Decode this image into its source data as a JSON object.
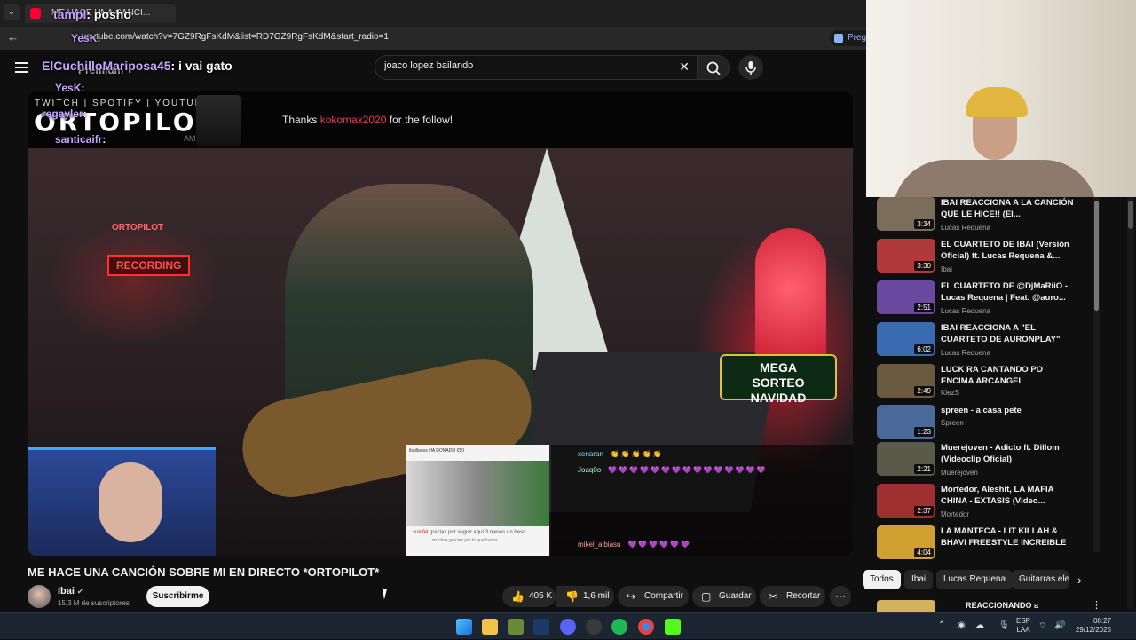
{
  "browser": {
    "tab_title": "ME HACE UNA CANCI...",
    "url": "youtube.com/watch?v=7GZ9RgFsKdM&list=RD7GZ9RgFsKdM&start_radio=1",
    "translate_label": "Preg"
  },
  "search": {
    "query": "joaco lopez bailando",
    "clear_icon": "close-icon",
    "search_icon": "search-icon",
    "mic_icon": "mic-icon"
  },
  "overlay_chat": [
    {
      "name": "tampl",
      "text": "posho"
    },
    {
      "name": "YesK",
      "text": "Premium"
    },
    {
      "name": "ElCuchilloMariposa45",
      "text": "i vai gato"
    },
    {
      "name": "YesK",
      "text": ""
    },
    {
      "name": "regayler",
      "text": ""
    },
    {
      "name": "santicaifr",
      "text": ""
    }
  ],
  "player": {
    "banner_top": "TWITCH | SPOTIFY | YOUTUBE",
    "banner_brand": "ORTOPILOT",
    "banner_am": "AM",
    "follow_prefix": "Thanks ",
    "follow_user": "kokomax2020",
    "follow_suffix": " for the follow!",
    "rec_sign": "RECORDING",
    "orto_sign": "ORTOPILOT",
    "sorteo_line1": "MEGA",
    "sorteo_line2": "SORTEO",
    "sorteo_line3": "NAVIDAD",
    "donation_title": "ibaillanos HA DONADO €50",
    "donation_msg": "gracias por seguir aquí 3 meses un beso",
    "donation_user": "suki94",
    "donation_sub": "muchas gracias por lo que haces",
    "stream_chat": [
      {
        "name": "xenaran",
        "msg": "👏👏👏👏👏"
      },
      {
        "name": "Joaq0o",
        "msg": "💜💜💜💜💜💜💜💜💜💜💜💜💜💜💜"
      },
      {
        "name": "mikel_albiasu",
        "msg": "💜💜💜💜💜💜"
      }
    ]
  },
  "video": {
    "title": "ME HACE UNA CANCIÓN SOBRE MI EN DIRECTO *ORTOPILOT*",
    "channel": "Ibai",
    "subscribers": "15,3 M de suscriptores",
    "subscribe_label": "Suscribirme",
    "likes": "405 K",
    "dislikes": "1,6 mil",
    "share_label": "Compartir",
    "save_label": "Guardar",
    "clip_label": "Recortar",
    "more_label": "···"
  },
  "related": [
    {
      "title": "IBAI REACCIONA A LA CANCIÓN QUE LE HICE!! (El...",
      "channel": "Lucas Requena",
      "duration": "3:34",
      "color": "#7a6d5a"
    },
    {
      "title": "EL CUARTETO DE IBAI (Versión Oficial) ft. Lucas Requena &...",
      "channel": "Ibai",
      "duration": "3:30",
      "color": "#b03a3a"
    },
    {
      "title": "EL CUARTETO DE @DjMaRiiO - Lucas Requena | Feat. @auro...",
      "channel": "Lucas Requena",
      "duration": "2:51",
      "color": "#6a4aa0"
    },
    {
      "title": "IBAI REACCIONA A \"EL CUARTETO DE AURONPLAY\"",
      "channel": "Lucas Requena",
      "duration": "6:02",
      "color": "#3a6ab0"
    },
    {
      "title": "LUCK RA CANTANDO PO ENCIMA ARCANGEL",
      "channel": "KiezS",
      "duration": "2:49",
      "color": "#6a5a40"
    },
    {
      "title": "spreen - a casa pete",
      "channel": "Spreen",
      "duration": "1:23",
      "color": "#4a6a9a"
    },
    {
      "title": "Muerejoven - Adicto ft. Dillom (Videoclip Oficial)",
      "channel": "Muerejoven",
      "duration": "2:21",
      "color": "#5a5a4a"
    },
    {
      "title": "Mortedor, Aleshit, LA MAFIA CHINA - EXTASIS (Video...",
      "channel": "Mortedor",
      "duration": "2:37",
      "color": "#a03030"
    },
    {
      "title": "LA MANTECA - LIT KILLAH & BHAVI FREESTYLE INCREIBLE",
      "channel": "",
      "duration": "4:04",
      "color": "#d0a030"
    }
  ],
  "chips": [
    "Todos",
    "Ibai",
    "Lucas Requena",
    "Guitarras ele"
  ],
  "next_item": "REACCIONANDO a",
  "tray": {
    "lang_1": "ESP",
    "lang_2": "LAA",
    "time": "08:27",
    "date": "29/12/2025"
  }
}
